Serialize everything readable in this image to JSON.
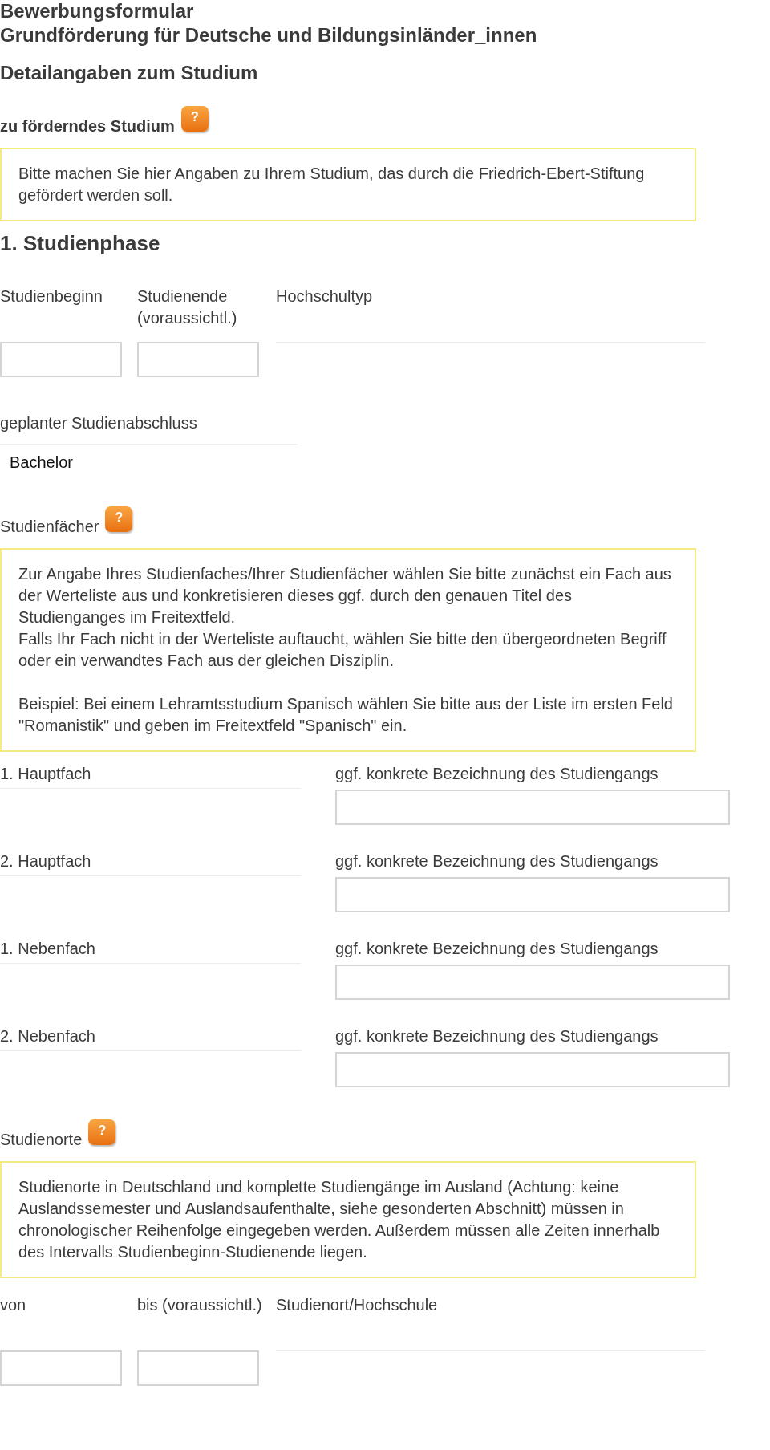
{
  "header": {
    "title": "Bewerbungsformular",
    "subtitle": "Grundförderung für Deutsche und Bildungsinländer_innen"
  },
  "page_heading": "Detailangaben zum Studium",
  "study": {
    "heading": "zu förderndes Studium",
    "help": "?",
    "info": [
      [
        "Bitte machen Sie hier Angaben zu Ihrem Studium, das durch die Friedrich-Ebert-Stiftung gefördert werden soll."
      ]
    ]
  },
  "phase": {
    "heading": "1. Studienphase",
    "fields": [
      {
        "kind": "date",
        "label": "Studienbeginn"
      },
      {
        "kind": "date",
        "label": "Studienende (voraussichtl.)"
      },
      {
        "kind": "select",
        "label": "Hochschultyp"
      }
    ]
  },
  "degree": {
    "label": "geplanter Studienabschluss",
    "value": "Bachelor"
  },
  "subjects": {
    "heading": "Studienfächer",
    "help": "?",
    "info": [
      [
        "Zur Angabe Ihres Studienfaches/Ihrer Studienfächer wählen Sie bitte zunächst ein Fach aus der Werteliste aus und konkretisieren dieses ggf. durch den genauen Titel des Studienganges im Freitextfeld.",
        "Falls Ihr Fach nicht in der Werteliste auftaucht, wählen Sie bitte den übergeordneten Begriff oder ein verwandtes Fach aus der gleichen Disziplin."
      ],
      [
        "Beispiel: Bei einem Lehramtsstudium Spanisch wählen Sie bitte aus der Liste im ersten Feld \"Romanistik\" und geben im Freitextfeld \"Spanisch\" ein."
      ]
    ],
    "rows": [
      {
        "label": "1. Hauptfach",
        "detail_label": "ggf. konkrete Bezeichnung des Studiengangs"
      },
      {
        "label": "2. Hauptfach",
        "detail_label": "ggf. konkrete Bezeichnung des Studiengangs"
      },
      {
        "label": "1. Nebenfach",
        "detail_label": "ggf. konkrete Bezeichnung des Studiengangs"
      },
      {
        "label": "2. Nebenfach",
        "detail_label": "ggf. konkrete Bezeichnung des Studiengangs"
      }
    ]
  },
  "locations": {
    "heading": "Studienorte",
    "help": "?",
    "info": [
      [
        "Studienorte in Deutschland und komplette Studiengänge im Ausland (Achtung: keine Auslandssemester und Auslandsaufenthalte, siehe gesonderten Abschnitt) müssen in chronologischer Reihenfolge eingegeben werden. Außerdem müssen alle Zeiten innerhalb des Intervalls Studienbeginn-Studienende liegen."
      ]
    ],
    "fields": [
      {
        "kind": "date",
        "label": "von"
      },
      {
        "kind": "date",
        "label": "bis (voraussichtl.)"
      },
      {
        "kind": "select",
        "label": "Studienort/Hochschule"
      }
    ]
  }
}
